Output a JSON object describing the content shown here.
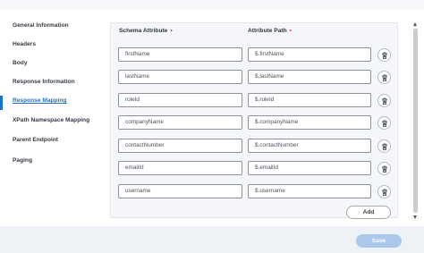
{
  "nav": {
    "items": [
      {
        "label": "General Information"
      },
      {
        "label": "Headers"
      },
      {
        "label": "Body"
      },
      {
        "label": "Response Information"
      },
      {
        "label": "Response Mapping"
      },
      {
        "label": "XPath Namespace Mapping"
      },
      {
        "label": "Parent Endpoint"
      },
      {
        "label": "Paging"
      }
    ],
    "active": "Response Mapping"
  },
  "mapping": {
    "schema_header": "Schema Attribute",
    "path_header": "Attribute Path",
    "required_marker": "•",
    "rows": [
      {
        "schema": "firstName",
        "path": "$.firstName"
      },
      {
        "schema": "lastName",
        "path": "$.lastName"
      },
      {
        "schema": "roleId",
        "path": "$.roleId"
      },
      {
        "schema": "companyName",
        "path": "$.companyName"
      },
      {
        "schema": "contactNumber",
        "path": "$.contactNumber"
      },
      {
        "schema": "emailId",
        "path": "$.emailId"
      },
      {
        "schema": "username",
        "path": "$.username"
      }
    ],
    "add_label": "Add"
  },
  "footer": {
    "save_label": "Save"
  },
  "colors": {
    "accent": "#1a73c7",
    "required": "#d9342b",
    "save_disabled": "#a9c8ec"
  },
  "icons": {
    "row_action": "trash-icon"
  }
}
